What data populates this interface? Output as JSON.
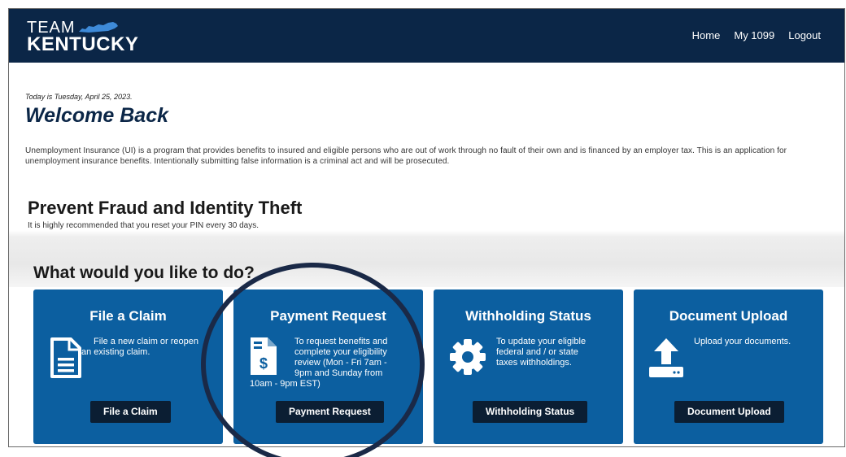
{
  "header": {
    "logo_team": "TEAM",
    "logo_state": "KENTUCKY",
    "nav": [
      "Home",
      "My 1099",
      "Logout"
    ]
  },
  "main": {
    "date_line": "Today is Tuesday, April 25, 2023.",
    "welcome": "Welcome Back",
    "intro": "Unemployment Insurance (UI) is a program that provides benefits to insured and eligible persons who are out of work through no fault of their own and is financed by an employer tax. This is an application for unemployment insurance benefits. Intentionally submitting false information is a criminal act and will be prosecuted.",
    "fraud_title": "Prevent Fraud and Identity Theft",
    "fraud_sub": "It is highly recommended that you reset your PIN every 30 days.",
    "question": "What would you like to do?"
  },
  "cards": [
    {
      "title": "File a Claim",
      "icon": "document-icon",
      "desc_line1": "File a new claim or reopen",
      "desc_line2": "an existing claim.",
      "button": "File a Claim"
    },
    {
      "title": "Payment Request",
      "icon": "payment-document-icon",
      "desc_a": "To request benefits and",
      "desc_b": "complete your eligibility",
      "desc_c": "review (Mon - Fri 7am -",
      "desc_d": "9pm and Sunday from",
      "desc_e": "10am - 9pm EST)",
      "button": "Payment Request"
    },
    {
      "title": "Withholding Status",
      "icon": "gear-icon",
      "desc_a": "To update your eligible",
      "desc_b": "federal and / or state",
      "desc_c": "taxes withholdings.",
      "button": "Withholding Status"
    },
    {
      "title": "Document Upload",
      "icon": "upload-icon",
      "desc_a": "Upload your documents.",
      "button": "Document Upload"
    }
  ],
  "colors": {
    "header_bg": "#0b2647",
    "card_bg": "#0c5fa0",
    "button_bg": "#0b1e33",
    "annotation_circle": "#1a2947"
  }
}
